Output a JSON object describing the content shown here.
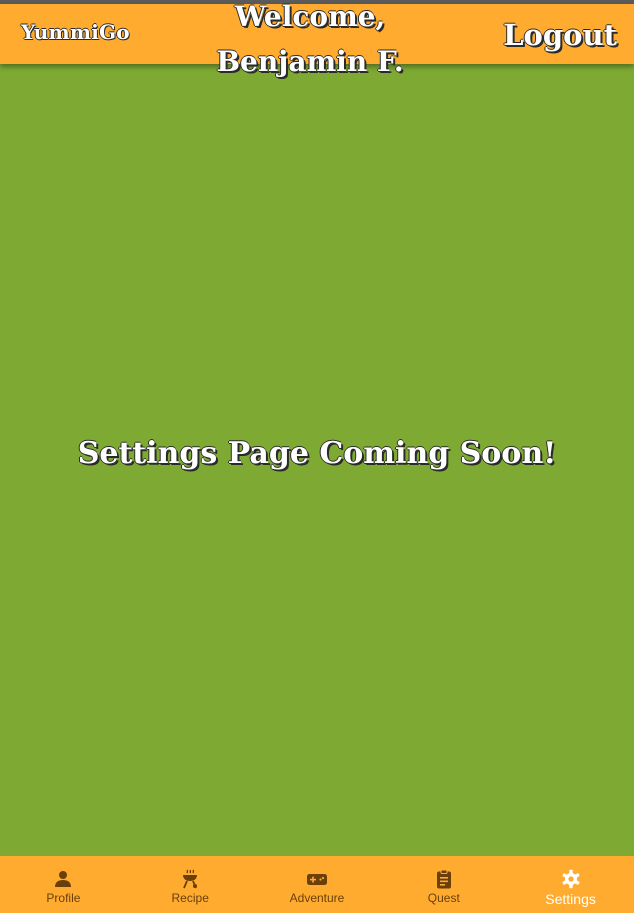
{
  "header": {
    "brand": "YummiGo",
    "welcome_line1": "Welcome,",
    "welcome_line2": "Benjamin F.",
    "logout_label": "Logout"
  },
  "main": {
    "message": "Settings Page Coming Soon!"
  },
  "bottom_nav": {
    "active": "Settings",
    "items": [
      {
        "label": "Profile",
        "icon": "person-icon"
      },
      {
        "label": "Recipe",
        "icon": "grill-icon"
      },
      {
        "label": "Adventure",
        "icon": "gamepad-icon"
      },
      {
        "label": "Quest",
        "icon": "clipboard-icon"
      },
      {
        "label": "Settings",
        "icon": "gear-icon"
      }
    ]
  },
  "colors": {
    "header_bg": "#ffab2f",
    "page_bg": "#7eaa33",
    "nav_inactive": "#6b3f0a",
    "nav_active": "#ffffff"
  }
}
